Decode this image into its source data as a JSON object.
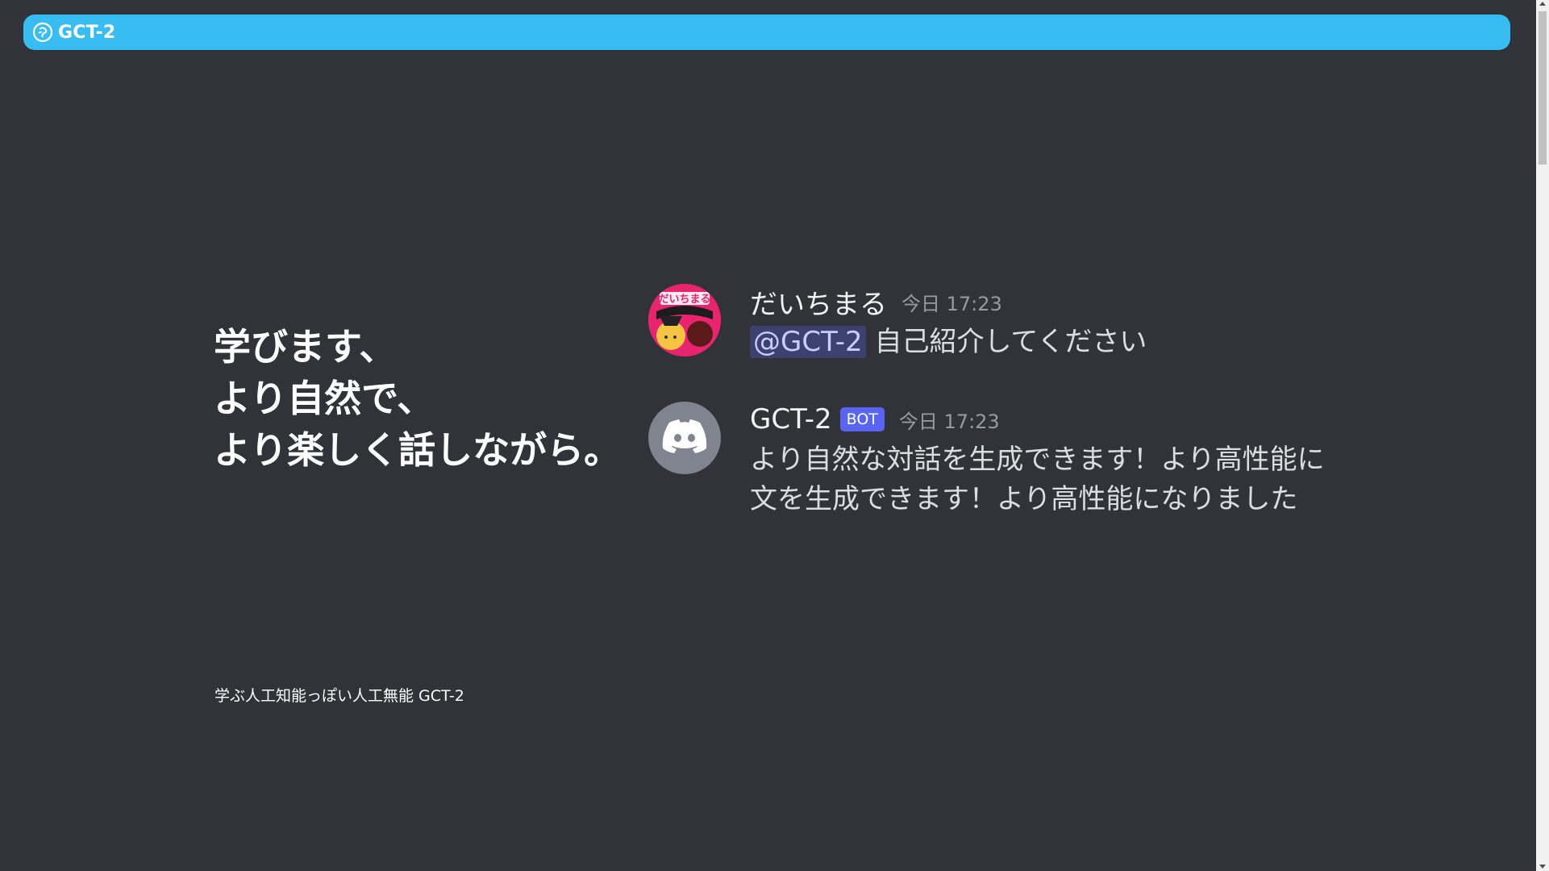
{
  "header": {
    "title": "GCT-2",
    "logo_icon": "brain-icon",
    "color": "#38bdf2"
  },
  "tagline": {
    "lines": [
      "学びます、",
      "より自然で、",
      "より楽しく話しながら。"
    ]
  },
  "footer_caption": "学ぶ人工知能っぽい人工無能 GCT-2",
  "messages": [
    {
      "author": "だいちまる",
      "timestamp": "今日 17:23",
      "mention": "@GCT-2",
      "content": "自己紹介してください",
      "avatar_text": "だいちまる"
    },
    {
      "author": "GCT-2",
      "badge": "BOT",
      "timestamp": "今日 17:23",
      "content": "より自然な対話を生成できます！より高性能に文を生成できます！より高性能になりました",
      "avatar_icon": "discord-icon"
    }
  ],
  "colors": {
    "background": "#313338",
    "bot_badge": "#5865f2",
    "mention_bg": "#3c4270"
  }
}
